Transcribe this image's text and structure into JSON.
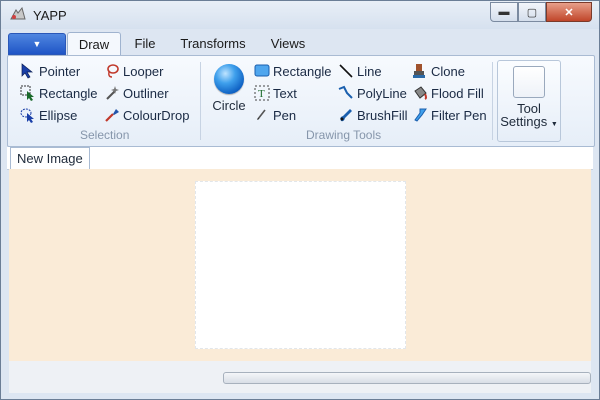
{
  "window": {
    "title": "YAPP"
  },
  "ribbon_tabs": [
    "Draw",
    "File",
    "Transforms",
    "Views"
  ],
  "selection": {
    "label": "Selection",
    "items": [
      "Pointer",
      "Looper",
      "Rectangle",
      "Outliner",
      "Ellipse",
      "ColourDrop"
    ]
  },
  "drawing_tools": {
    "label": "Drawing Tools",
    "circle": "Circle",
    "items": [
      "Rectangle",
      "Line",
      "Clone",
      "Text",
      "PolyLine",
      "Flood Fill",
      "Pen",
      "BrushFill",
      "Filter Pen"
    ]
  },
  "tool_settings": {
    "line1": "Tool",
    "line2": "Settings"
  },
  "document_tab": "New Image",
  "colors": {
    "canvas_background": "#faebd7",
    "ribbon_blue": "#1f55c6"
  }
}
